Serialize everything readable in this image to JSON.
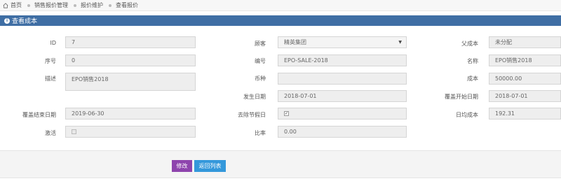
{
  "breadcrumb": [
    "首页",
    "销售报价管理",
    "报价维护",
    "查看报价"
  ],
  "panel": {
    "title": "查看成本"
  },
  "fields": {
    "id": {
      "label": "ID",
      "value": "7"
    },
    "customer": {
      "label": "顾客",
      "value": "精英集团"
    },
    "parent": {
      "label": "父成本",
      "value": "未分配"
    },
    "seq": {
      "label": "序号",
      "value": "0"
    },
    "code": {
      "label": "编号",
      "value": "EPO-SALE-2018"
    },
    "name": {
      "label": "名称",
      "value": "EPO销售2018"
    },
    "desc": {
      "label": "描述",
      "value": "EPO销售2018"
    },
    "currency": {
      "label": "币种",
      "value": ""
    },
    "cost": {
      "label": "成本",
      "value": "50000.00"
    },
    "occur_date": {
      "label": "发生日期",
      "value": "2018-07-01"
    },
    "start_date": {
      "label": "覆盖开始日期",
      "value": "2018-07-01"
    },
    "end_date": {
      "label": "覆盖结束日期",
      "value": "2019-06-30"
    },
    "holiday": {
      "label": "去除节假日",
      "checked": true
    },
    "daily": {
      "label": "日均成本",
      "value": "192.31"
    },
    "active": {
      "label": "激活",
      "checked": false
    },
    "ratio": {
      "label": "比率",
      "value": "0.00"
    }
  },
  "buttons": {
    "edit": "修改",
    "back": "返回列表"
  }
}
